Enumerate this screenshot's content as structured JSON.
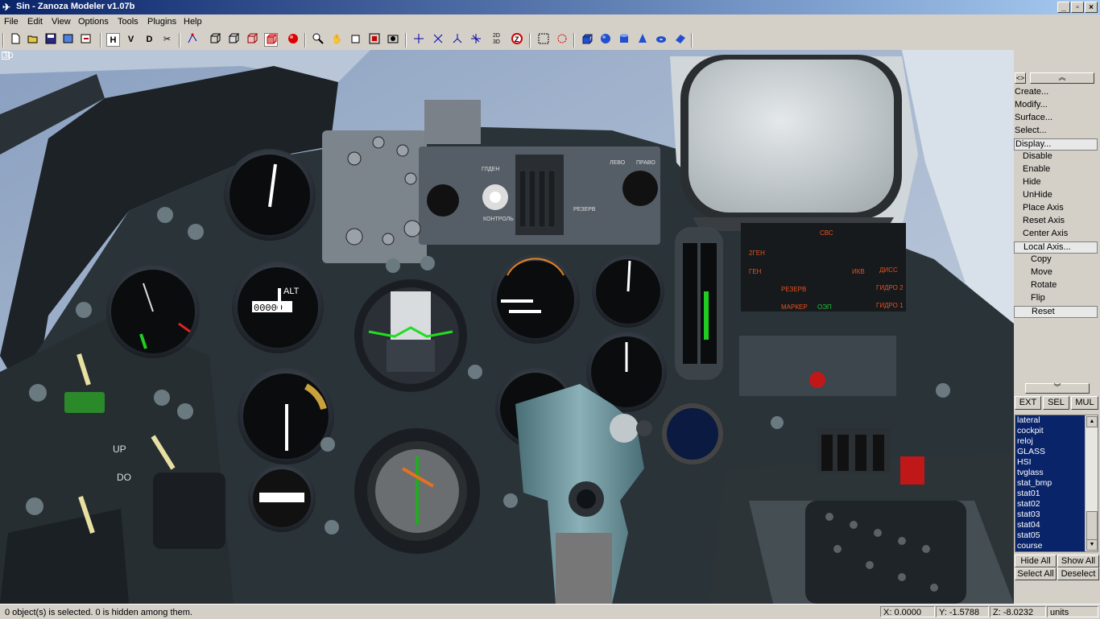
{
  "window": {
    "title": "Sin - Zanoza Modeler v1.07b",
    "buttons": [
      "_",
      "▫",
      "×"
    ]
  },
  "menubar": {
    "items": [
      "File",
      "Edit",
      "View",
      "Options",
      "Tools",
      "Plugins",
      "Help"
    ]
  },
  "toolbar": {
    "letters": [
      "H",
      "V",
      "D"
    ]
  },
  "viewport": {
    "label": "3D"
  },
  "panel": {
    "arrow_up": "︽",
    "arrow_down": "︾",
    "toggle": "<>",
    "menu": [
      {
        "label": "Create...",
        "level": 1
      },
      {
        "label": "Modify...",
        "level": 1
      },
      {
        "label": "Surface...",
        "level": 1
      },
      {
        "label": "Select...",
        "level": 1
      },
      {
        "label": "Display...",
        "level": 1,
        "selected": true
      },
      {
        "label": "Disable",
        "level": 2
      },
      {
        "label": "Enable",
        "level": 2
      },
      {
        "label": "Hide",
        "level": 2
      },
      {
        "label": "UnHide",
        "level": 2
      },
      {
        "label": "Place Axis",
        "level": 2
      },
      {
        "label": "Reset Axis",
        "level": 2
      },
      {
        "label": "Center Axis",
        "level": 2
      },
      {
        "label": "Local Axis...",
        "level": 2,
        "selected": true
      },
      {
        "label": "Copy",
        "level": 3
      },
      {
        "label": "Move",
        "level": 3
      },
      {
        "label": "Rotate",
        "level": 3
      },
      {
        "label": "Flip",
        "level": 3
      },
      {
        "label": "Reset",
        "level": 3,
        "selected": true
      }
    ],
    "mode_buttons": [
      "EXT",
      "SEL",
      "MUL"
    ],
    "objects": [
      "lateral",
      "cockpit",
      "reloj",
      "GLASS",
      "HSI",
      "tvglass",
      "stat_bmp",
      "stat01",
      "stat02",
      "stat03",
      "stat04",
      "stat05",
      "course"
    ],
    "hide_all": "Hide All",
    "show_all": "Show All",
    "select_all": "Select All",
    "deselect": "Deselect"
  },
  "status": {
    "message": "0 object(s) is selected. 0 is hidden among them.",
    "x": "X: 0.0000",
    "y": "Y: -1.5788",
    "z": "Z: -8.0232",
    "units": "units"
  },
  "cockpit": {
    "alt_label": "ALT",
    "alt_digits": "00000",
    "labels": [
      "UP",
      "DO",
      "СВС",
      "2ГЕН",
      "ГЕН",
      "ИКВ",
      "ДИСС",
      "РЕЗЕРВ",
      "МАРКЕР",
      "ОЭП",
      "ГИДРО 2",
      "ГИДРО 1",
      "РЕЗЕРВ",
      "КОНТРОЛЬ",
      "ГЛДЕН",
      "ПРАВО",
      "ЛЕВО"
    ]
  }
}
